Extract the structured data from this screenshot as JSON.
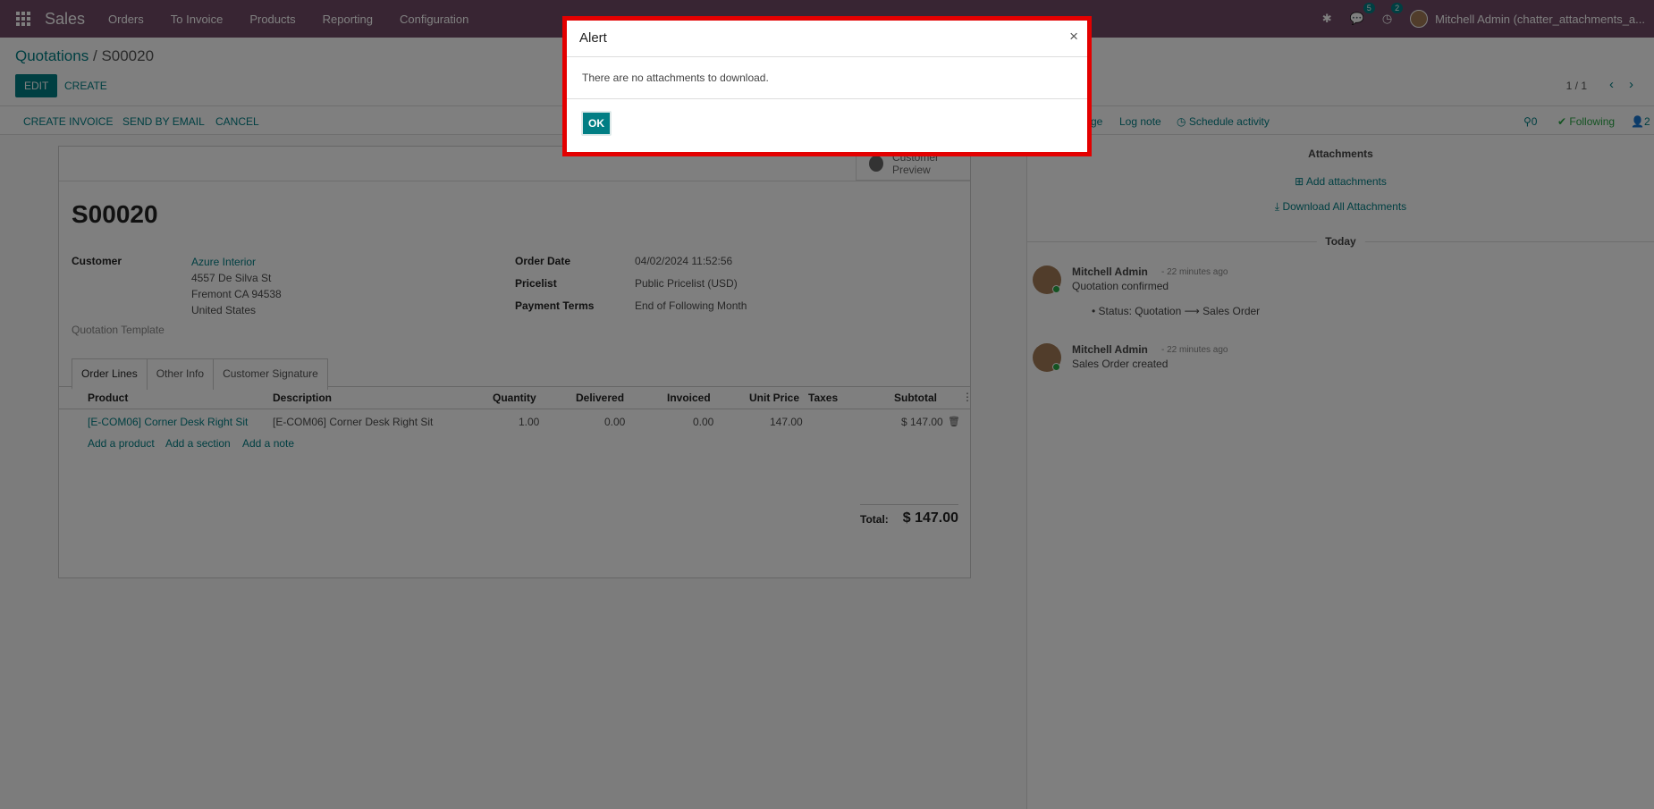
{
  "nav": {
    "brand": "Sales",
    "menu": [
      "Orders",
      "To Invoice",
      "Products",
      "Reporting",
      "Configuration"
    ],
    "discuss_count": "5",
    "activity_count": "2",
    "user_name": "Mitchell Admin (chatter_attachments_a..."
  },
  "breadcrumb": {
    "parent": "Quotations",
    "separator": "/",
    "current": "S00020"
  },
  "actions": {
    "edit": "EDIT",
    "create": "CREATE",
    "pager": "1 / 1"
  },
  "status_buttons": [
    "CREATE INVOICE",
    "SEND BY EMAIL",
    "CANCEL"
  ],
  "chatter_top": {
    "send_message_fragment": "ge",
    "log_note": "Log note",
    "schedule_activity": "Schedule activity",
    "attachment_count": "0",
    "following": "Following",
    "follower_count": "2"
  },
  "form": {
    "customer_preview": "Customer Preview",
    "order_name": "S00020",
    "customer_label": "Customer",
    "customer_name": "Azure Interior",
    "address1": "4557 De Silva St",
    "address2": "Fremont CA 94538",
    "address3": "United States",
    "quotation_template_label": "Quotation Template",
    "order_date_label": "Order Date",
    "order_date": "04/02/2024 11:52:56",
    "pricelist_label": "Pricelist",
    "pricelist": "Public Pricelist (USD)",
    "payment_terms_label": "Payment Terms",
    "payment_terms": "End of Following Month",
    "tabs": [
      "Order Lines",
      "Other Info",
      "Customer Signature"
    ],
    "columns": [
      "Product",
      "Description",
      "Quantity",
      "Delivered",
      "Invoiced",
      "Unit Price",
      "Taxes",
      "Subtotal"
    ],
    "line": {
      "product": "[E-COM06] Corner Desk Right Sit",
      "description": "[E-COM06] Corner Desk Right Sit",
      "quantity": "1.00",
      "delivered": "0.00",
      "invoiced": "0.00",
      "unit_price": "147.00",
      "taxes": "",
      "subtotal": "$ 147.00"
    },
    "add_product": "Add a product",
    "add_section": "Add a section",
    "add_note": "Add a note",
    "total_label": "Total:",
    "total_value": "$ 147.00"
  },
  "chatter": {
    "attachments_title": "Attachments",
    "add_attachments": "Add attachments",
    "download_all": "Download All Attachments",
    "today": "Today",
    "messages": [
      {
        "author": "Mitchell Admin",
        "time": "- 22 minutes ago",
        "body": "Quotation confirmed",
        "tracking": "Status: Quotation ⟶ Sales Order"
      },
      {
        "author": "Mitchell Admin",
        "time": "- 22 minutes ago",
        "body": "Sales Order created"
      }
    ]
  },
  "dialog": {
    "title": "Alert",
    "close": "×",
    "body": "There are no attachments to download.",
    "ok": "OK"
  },
  "colors": {
    "topbar": "#714b67",
    "primary": "#017e84",
    "highlight": "#e30000",
    "following": "#28a745"
  }
}
